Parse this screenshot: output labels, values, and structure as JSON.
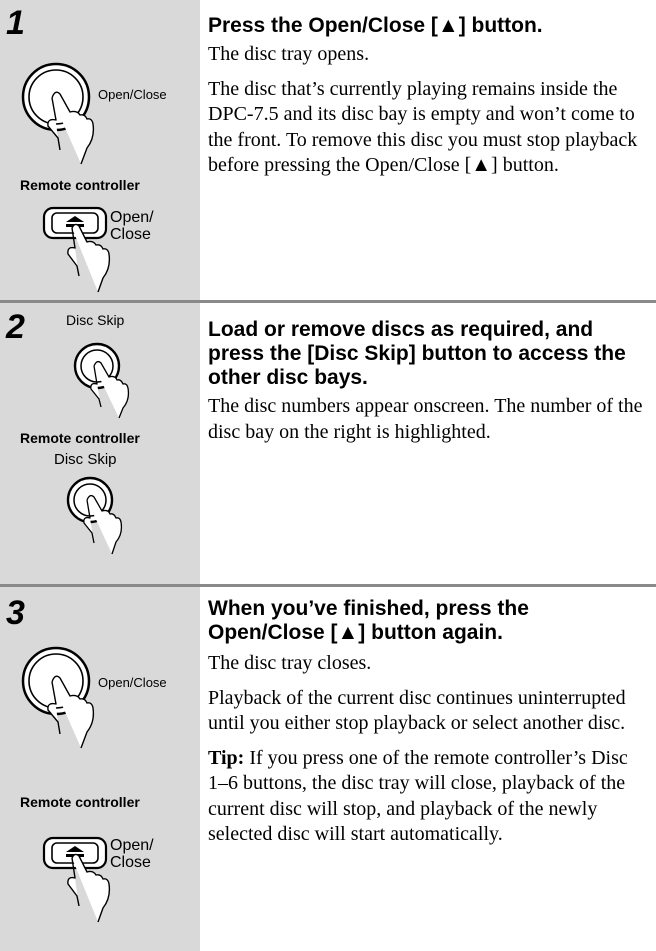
{
  "steps": [
    {
      "number": "1",
      "heading": "Press the Open/Close [▲] button.",
      "paragraphs": [
        "The disc tray opens.",
        "The disc that’s currently playing remains inside the DPC-7.5 and its disc bay is empty and won’t come to the front. To remove this disc you must stop playback before pressing the Open/Close [▲] button."
      ],
      "panel_button_label": "Open/Close",
      "remote_label": "Remote controller",
      "remote_button_label": "Open/ Close"
    },
    {
      "number": "2",
      "heading": "Load or remove discs as required, and press the [Disc Skip] button to access the other disc bays.",
      "paragraphs": [
        "The disc numbers appear onscreen. The number of the disc bay on the right is highlighted."
      ],
      "panel_button_label": "Disc Skip",
      "remote_label": "Remote controller",
      "remote_button_label": "Disc Skip"
    },
    {
      "number": "3",
      "heading": "When you’ve finished, press the Open/Close [▲] button again.",
      "paragraphs": [
        "The disc tray closes.",
        "Playback of the current disc continues uninterrupted until you either stop playback or select another disc."
      ],
      "tip_label": "Tip:",
      "tip_text": "If you press one of the remote controller’s Disc 1–6 buttons, the disc tray will close, playback of the current disc will stop, and playback of the newly selected disc will start automatically.",
      "panel_button_label": "Open/Close",
      "remote_label": "Remote controller",
      "remote_button_label": "Open/ Close"
    }
  ],
  "icons": [
    "round-button-hand-icon",
    "eject-button-hand-icon"
  ],
  "colors": {
    "sidebar": "#d9d9d9",
    "rule": "#8a8a8a",
    "text": "#000000"
  }
}
